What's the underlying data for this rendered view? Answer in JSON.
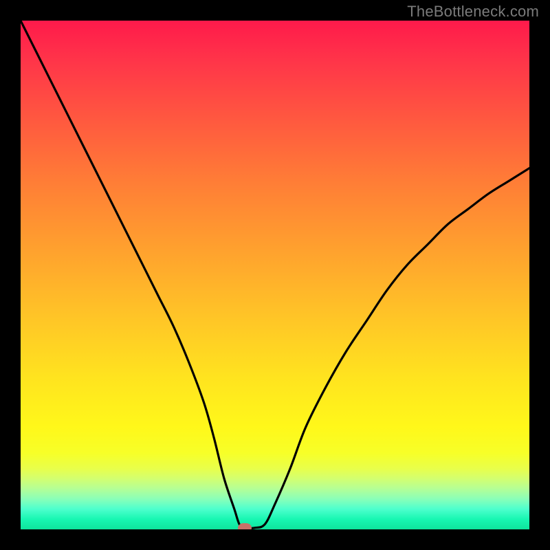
{
  "watermark": "TheBottleneck.com",
  "colors": {
    "frame": "#000000",
    "watermark_text": "#7b7b7b",
    "curve_stroke": "#000000",
    "marker_fill": "#c77168",
    "gradient_stops": [
      "#ff1a4b",
      "#ff3549",
      "#ff5a3f",
      "#ff7e36",
      "#ffa12e",
      "#ffc427",
      "#ffe31f",
      "#fff81a",
      "#f7ff28",
      "#e9ff4a",
      "#d3ff70",
      "#b4ff96",
      "#8affb8",
      "#4dffcd",
      "#18f7b2",
      "#0ee39c"
    ]
  },
  "chart_data": {
    "type": "line",
    "title": "",
    "xlabel": "",
    "ylabel": "",
    "xlim": [
      0,
      100
    ],
    "ylim": [
      0,
      100
    ],
    "grid": false,
    "legend": false,
    "series": [
      {
        "name": "bottleneck-curve",
        "x": [
          0,
          3,
          6,
          9,
          12,
          15,
          18,
          21,
          24,
          27,
          30,
          33,
          36,
          38,
          40,
          42,
          43,
          44,
          46,
          48,
          50,
          53,
          56,
          60,
          64,
          68,
          72,
          76,
          80,
          84,
          88,
          92,
          96,
          100
        ],
        "y": [
          100,
          94,
          88,
          82,
          76,
          70,
          64,
          58,
          52,
          46,
          40,
          33,
          25,
          18,
          10,
          4,
          1,
          0.3,
          0.3,
          1,
          5,
          12,
          20,
          28,
          35,
          41,
          47,
          52,
          56,
          60,
          63,
          66,
          68.5,
          71
        ]
      }
    ],
    "flat_segment": {
      "x_start": 41,
      "x_end": 46,
      "y": 0.3
    },
    "marker": {
      "x": 44,
      "y": 0.3
    },
    "annotations": []
  }
}
